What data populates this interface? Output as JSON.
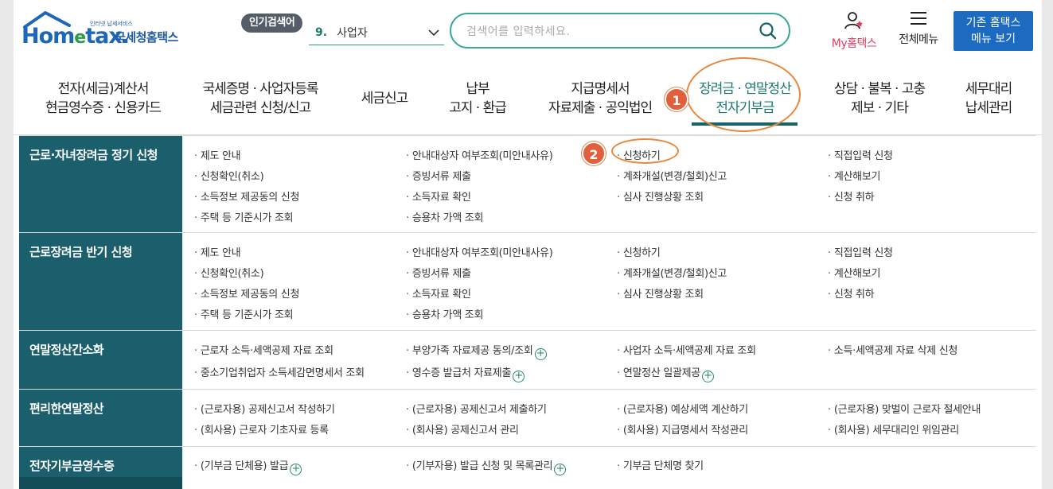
{
  "header": {
    "logo_small": "인터넷 납세서비스",
    "logo_word_a": "Hom",
    "logo_word_e": "e",
    "logo_word_b": "tax.",
    "logo_kr": "국세청홈택스",
    "popular_label": "인기검색어",
    "popular_rank": "9.",
    "popular_term": "사업자",
    "search_placeholder": "검색어를 입력하세요.",
    "my_label": "My홈택스",
    "allmenu_label": "전체메뉴",
    "old_btn_line1": "기존 홈택스",
    "old_btn_line2": "메뉴 보기"
  },
  "gnb": [
    {
      "l1": "전자(세금)계산서",
      "l2": "현금영수증 · 신용카드"
    },
    {
      "l1": "국세증명 · 사업자등록",
      "l2": "세금관련 신청/신고"
    },
    {
      "l1": "세금신고",
      "l2": ""
    },
    {
      "l1": "납부",
      "l2": "고지 · 환급"
    },
    {
      "l1": "지급명세서",
      "l2": "자료제출 · 공익법인"
    },
    {
      "l1": "장려금 · 연말정산",
      "l2": "전자기부금"
    },
    {
      "l1": "상담 · 불복 · 고충",
      "l2": "제보 · 기타"
    },
    {
      "l1": "세무대리",
      "l2": "납세관리"
    }
  ],
  "callouts": {
    "one": "1",
    "two": "2"
  },
  "sections": [
    {
      "title": "근로·자녀장려금 정기 신청",
      "cols": [
        [
          "제도 안내",
          "신청확인(취소)",
          "소득정보 제공동의 신청",
          "주택 등 기준시가 조회"
        ],
        [
          "안내대상자 여부조회(미안내사유)",
          "증빙서류 제출",
          "소득자료 확인",
          "승용차 가액 조회"
        ],
        [
          "신청하기",
          "계좌개설(변경/철회)신고",
          "심사 진행상황 조회"
        ],
        [
          "직접입력 신청",
          "계산해보기",
          "신청 취하"
        ]
      ]
    },
    {
      "title": "근로장려금 반기 신청",
      "cols": [
        [
          "제도 안내",
          "신청확인(취소)",
          "소득정보 제공동의 신청",
          "주택 등 기준시가 조회"
        ],
        [
          "안내대상자 여부조회(미안내사유)",
          "증빙서류 제출",
          "소득자료 확인",
          "승용차 가액 조회"
        ],
        [
          "신청하기",
          "계좌개설(변경/철회)신고",
          "심사 진행상황 조회"
        ],
        [
          "직접입력 신청",
          "계산해보기",
          "신청 취하"
        ]
      ]
    },
    {
      "title": "연말정산간소화",
      "cols": [
        [
          "근로자 소득·세액공제 자료 조회",
          "중소기업취업자 소득세감면명세서 조회"
        ],
        [
          "부양가족 자료제공 동의/조회",
          "영수증 발급처 자료제출"
        ],
        [
          "사업자 소득·세액공제 자료 조회",
          "연말정산 일괄제공"
        ],
        [
          "소득·세액공제 자료 삭제 신청"
        ]
      ]
    },
    {
      "title": "편리한연말정산",
      "cols": [
        [
          "(근로자용) 공제신고서 작성하기",
          "(회사용) 근로자 기초자료 등록"
        ],
        [
          "(근로자용) 공제신고서 제출하기",
          "(회사용) 공제신고서 관리"
        ],
        [
          "(근로자용) 예상세액 계산하기",
          "(회사용) 지급명세서 작성관리"
        ],
        [
          "(근로자용) 맞벌이 근로자 절세안내",
          "(회사용) 세무대리인 위임관리"
        ]
      ]
    },
    {
      "title": "전자기부금영수증",
      "cols": [
        [
          "(기부금 단체용) 발급"
        ],
        [
          "(기부자용) 발급 신청 및 목록관리"
        ],
        [
          "기부금 단체명 찾기"
        ],
        []
      ]
    }
  ]
}
